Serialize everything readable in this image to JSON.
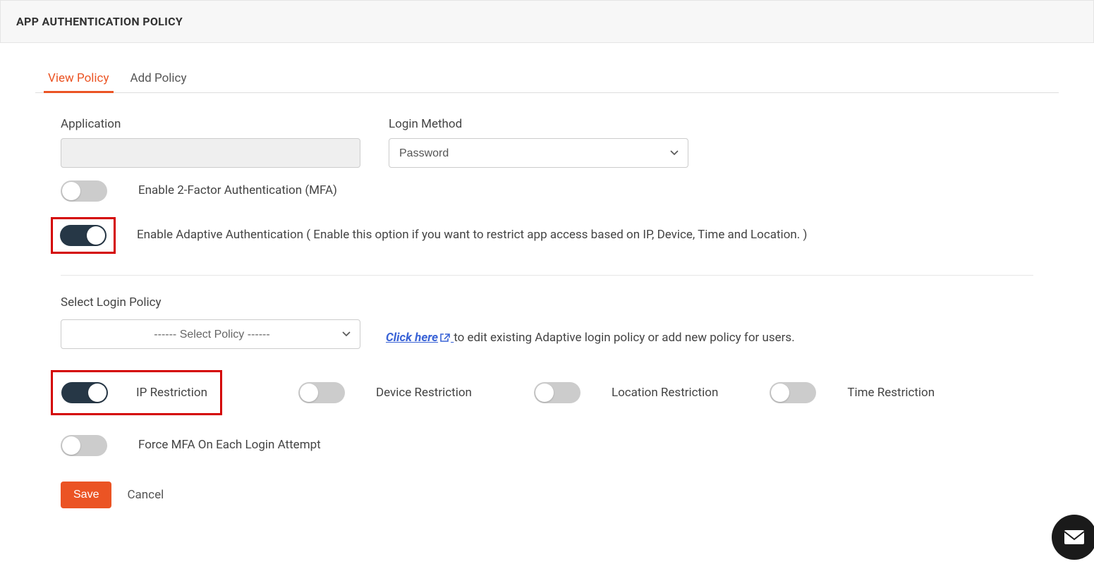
{
  "header": {
    "title": "APP AUTHENTICATION POLICY"
  },
  "tabs": {
    "view": "View Policy",
    "add": "Add Policy",
    "active": "view"
  },
  "fields": {
    "application_label": "Application",
    "application_value": "",
    "login_method_label": "Login Method",
    "login_method_value": "Password"
  },
  "toggles": {
    "mfa": {
      "label": "Enable 2-Factor Authentication (MFA)",
      "on": false
    },
    "adaptive": {
      "label": "Enable Adaptive Authentication ( Enable this option if you want to restrict app access based on IP, Device, Time and Location. )",
      "on": true
    },
    "ip": {
      "label": "IP Restriction",
      "on": true
    },
    "device": {
      "label": "Device Restriction",
      "on": false
    },
    "location": {
      "label": "Location Restriction",
      "on": false
    },
    "time": {
      "label": "Time Restriction",
      "on": false
    },
    "force_mfa": {
      "label": "Force MFA On Each Login Attempt",
      "on": false
    }
  },
  "policy": {
    "label": "Select Login Policy",
    "placeholder": "------ Select Policy ------",
    "click_here": "Click here",
    "hint_rest": " to edit existing Adaptive login policy or add new policy for users."
  },
  "actions": {
    "save": "Save",
    "cancel": "Cancel"
  }
}
